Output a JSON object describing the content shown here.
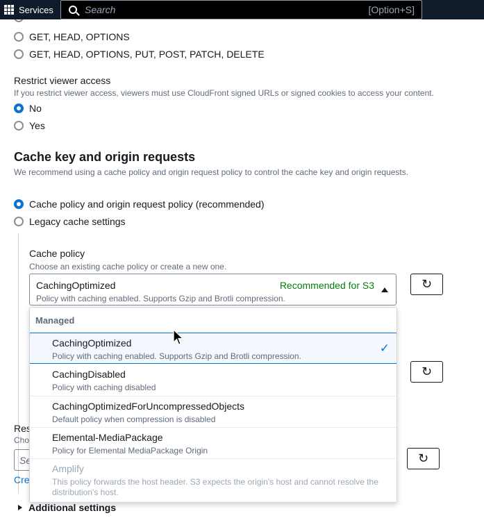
{
  "topbar": {
    "services_label": "Services",
    "search_placeholder": "Search",
    "search_shortcut": "[Option+S]"
  },
  "allowed_methods": {
    "options": [
      {
        "label": "GET, HEAD, OPTIONS",
        "checked": false
      },
      {
        "label": "GET, HEAD, OPTIONS, PUT, POST, PATCH, DELETE",
        "checked": false
      }
    ]
  },
  "restrict_viewer_access": {
    "label": "Restrict viewer access",
    "description": "If you restrict viewer access, viewers must use CloudFront signed URLs or signed cookies to access your content.",
    "options": [
      {
        "label": "No",
        "checked": true
      },
      {
        "label": "Yes",
        "checked": false
      }
    ]
  },
  "cache_key": {
    "title": "Cache key and origin requests",
    "description": "We recommend using a cache policy and origin request policy to control the cache key and origin requests.",
    "options": [
      {
        "label": "Cache policy and origin request policy (recommended)",
        "checked": true
      },
      {
        "label": "Legacy cache settings",
        "checked": false
      }
    ]
  },
  "cache_policy": {
    "label": "Cache policy",
    "description": "Choose an existing cache policy or create a new one.",
    "selected": {
      "title": "CachingOptimized",
      "description": "Policy with caching enabled. Supports Gzip and Brotli compression.",
      "tag": "Recommended for S3"
    },
    "dropdown": {
      "group_label": "Managed",
      "options": [
        {
          "title": "CachingOptimized",
          "description": "Policy with caching enabled. Supports Gzip and Brotli compression.",
          "selected": true,
          "disabled": false
        },
        {
          "title": "CachingDisabled",
          "description": "Policy with caching disabled",
          "selected": false,
          "disabled": false
        },
        {
          "title": "CachingOptimizedForUncompressedObjects",
          "description": "Default policy when compression is disabled",
          "selected": false,
          "disabled": false
        },
        {
          "title": "Elemental-MediaPackage",
          "description": "Policy for Elemental MediaPackage Origin",
          "selected": false,
          "disabled": false
        },
        {
          "title": "Amplify",
          "description": "This policy forwards the host header. S3 expects the origin's host and cannot resolve the distribution's host.",
          "selected": false,
          "disabled": true
        }
      ]
    }
  },
  "response_headers": {
    "label_fragment": "Resp",
    "description_fragment": "Choo",
    "input_fragment": "Se",
    "link_fragment": "Crea"
  },
  "additional_settings": {
    "label": "Additional settings"
  }
}
